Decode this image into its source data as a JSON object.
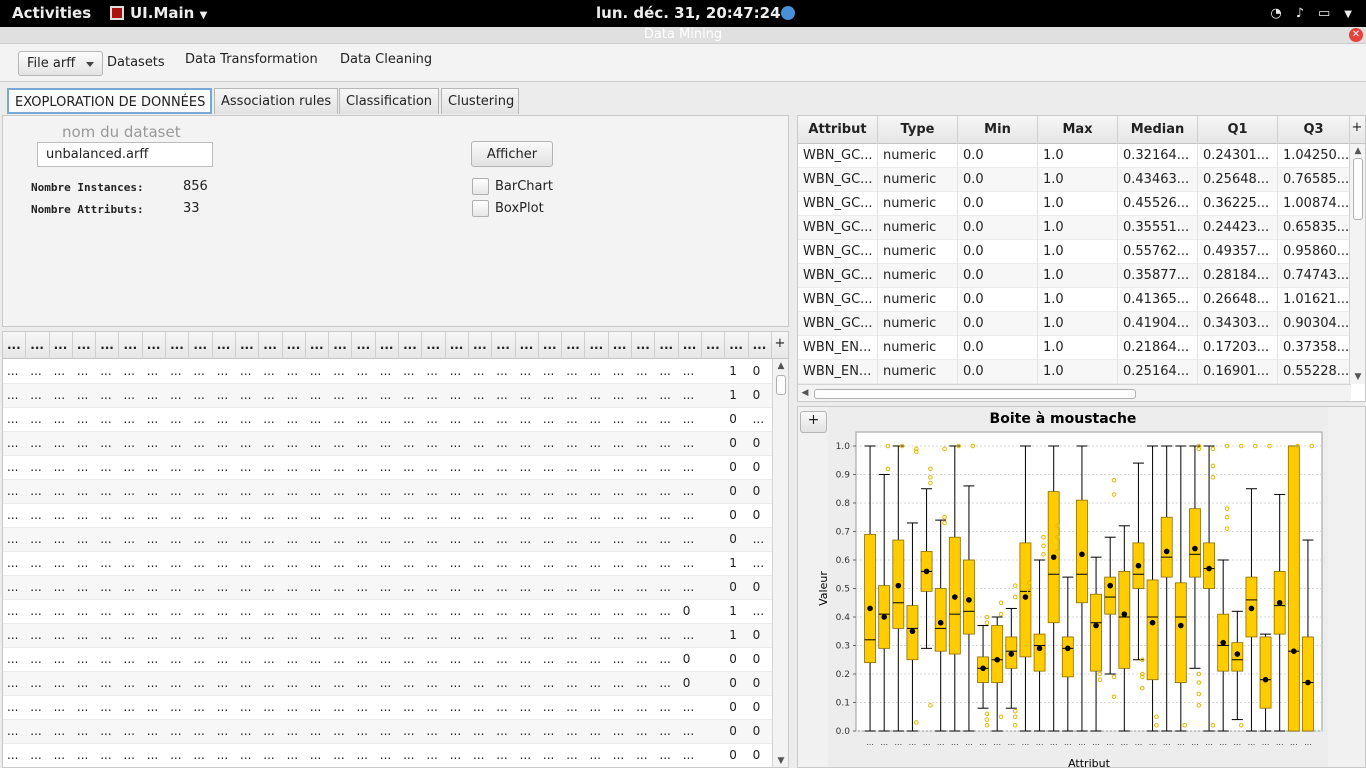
{
  "topbar": {
    "activities": "Activities",
    "app_menu": "UI.Main",
    "clock": "lun. déc. 31, 20:47:24"
  },
  "window": {
    "title": "Data Mining"
  },
  "menubar": {
    "file_button": "File arff",
    "items": [
      "Datasets",
      "Data Transformation",
      "Data Cleaning"
    ]
  },
  "tabs": [
    "EXOPLORATION DE DONNÉES",
    "Association rules",
    "Classification",
    "Clustering"
  ],
  "dataset": {
    "label": "nom du dataset",
    "value": "unbalanced.arff",
    "instances_label": "Nombre Instances:",
    "instances": "856",
    "attributes_label": "Nombre Attributs:",
    "attributes": "33",
    "afficher": "Afficher",
    "barchart": "BarChart",
    "boxplot": "BoxPlot"
  },
  "data_table": {
    "header_text": "...",
    "corner": "+",
    "cols": 33,
    "rows": [
      {
        "c30": "",
        "c31": "1",
        "c32": "0"
      },
      {
        "c30": "",
        "c31": "1",
        "c32": "0"
      },
      {
        "c30": "",
        "c31": "0",
        "c32": "..."
      },
      {
        "c30": "",
        "c31": "0",
        "c32": "0"
      },
      {
        "c30": "",
        "c31": "0",
        "c32": "0"
      },
      {
        "c30": "",
        "c31": "0",
        "c32": "0"
      },
      {
        "c30": "",
        "c31": "0",
        "c32": "0"
      },
      {
        "c30": "",
        "c31": "0",
        "c32": "..."
      },
      {
        "c30": "",
        "c31": "1",
        "c32": "..."
      },
      {
        "c30": "",
        "c31": "0",
        "c32": "0"
      },
      {
        "c29": "0",
        "c30": "",
        "c31": "1",
        "c32": "..."
      },
      {
        "c30": "",
        "c31": "1",
        "c32": "0"
      },
      {
        "c29": "0",
        "c30": "",
        "c31": "0",
        "c32": "0"
      },
      {
        "c29": "0",
        "c30": "",
        "c31": "0",
        "c32": "0"
      },
      {
        "c30": "",
        "c31": "0",
        "c32": "0"
      },
      {
        "c30": "",
        "c31": "0",
        "c32": "0"
      },
      {
        "c30": "",
        "c31": "0",
        "c32": "0"
      }
    ]
  },
  "stats_table": {
    "headers": [
      "Attribut",
      "Type",
      "Min",
      "Max",
      "Median",
      "Q1",
      "Q3"
    ],
    "corner": "+",
    "rows": [
      [
        "WBN_GC...",
        "numeric",
        "0.0",
        "1.0",
        "0.32164...",
        "0.24301...",
        "1.04250..."
      ],
      [
        "WBN_GC...",
        "numeric",
        "0.0",
        "1.0",
        "0.43463...",
        "0.25648...",
        "0.76585..."
      ],
      [
        "WBN_GC...",
        "numeric",
        "0.0",
        "1.0",
        "0.45526...",
        "0.36225...",
        "1.00874..."
      ],
      [
        "WBN_GC...",
        "numeric",
        "0.0",
        "1.0",
        "0.35551...",
        "0.24423...",
        "0.65835..."
      ],
      [
        "WBN_GC...",
        "numeric",
        "0.0",
        "1.0",
        "0.55762...",
        "0.49357...",
        "0.95860..."
      ],
      [
        "WBN_GC...",
        "numeric",
        "0.0",
        "1.0",
        "0.35877...",
        "0.28184...",
        "0.74743..."
      ],
      [
        "WBN_GC...",
        "numeric",
        "0.0",
        "1.0",
        "0.41365...",
        "0.26648...",
        "1.01621..."
      ],
      [
        "WBN_GC...",
        "numeric",
        "0.0",
        "1.0",
        "0.41904...",
        "0.34303...",
        "0.90304..."
      ],
      [
        "WBN_EN...",
        "numeric",
        "0.0",
        "1.0",
        "0.21864...",
        "0.17203...",
        "0.37358..."
      ],
      [
        "WBN_EN...",
        "numeric",
        "0.0",
        "1.0",
        "0.25164...",
        "0.16901...",
        "0.55228..."
      ]
    ]
  },
  "chart_panel": {
    "plus": "+"
  },
  "chart_data": {
    "type": "box",
    "title": "Boite à moustache",
    "xlabel": "Attribut",
    "ylabel": "Valeur",
    "ylim": [
      0,
      1
    ],
    "yticks": [
      "0.0",
      "0.1",
      "0.2",
      "0.3",
      "0.4",
      "0.5",
      "0.6",
      "0.7",
      "0.8",
      "0.9",
      "1.0"
    ],
    "category_label": "...",
    "colors": {
      "box": "#ffcc00",
      "box_stroke": "#8a6d00",
      "outlier": "#e6b800",
      "mean": "#000000",
      "grid": "#d8d8d8"
    },
    "boxes": [
      {
        "q1": 0.24,
        "med": 0.32,
        "q3": 0.69,
        "min": 0.0,
        "max": 1.0,
        "mean": 0.43
      },
      {
        "q1": 0.29,
        "med": 0.41,
        "q3": 0.51,
        "min": 0.0,
        "max": 0.9,
        "mean": 0.4
      },
      {
        "q1": 0.36,
        "med": 0.45,
        "q3": 0.67,
        "min": 0.0,
        "max": 1.0,
        "mean": 0.51
      },
      {
        "q1": 0.25,
        "med": 0.36,
        "q3": 0.44,
        "min": 0.0,
        "max": 0.73,
        "mean": 0.35
      },
      {
        "q1": 0.49,
        "med": 0.56,
        "q3": 0.63,
        "min": 0.29,
        "max": 0.85,
        "mean": 0.56
      },
      {
        "q1": 0.28,
        "med": 0.36,
        "q3": 0.5,
        "min": 0.0,
        "max": 0.74,
        "mean": 0.38
      },
      {
        "q1": 0.27,
        "med": 0.41,
        "q3": 0.68,
        "min": 0.0,
        "max": 1.0,
        "mean": 0.47
      },
      {
        "q1": 0.34,
        "med": 0.42,
        "q3": 0.6,
        "min": 0.0,
        "max": 0.86,
        "mean": 0.46
      },
      {
        "q1": 0.17,
        "med": 0.22,
        "q3": 0.26,
        "min": 0.08,
        "max": 0.37,
        "mean": 0.22
      },
      {
        "q1": 0.17,
        "med": 0.25,
        "q3": 0.37,
        "min": 0.0,
        "max": 0.4,
        "mean": 0.25
      },
      {
        "q1": 0.22,
        "med": 0.28,
        "q3": 0.33,
        "min": 0.08,
        "max": 0.43,
        "mean": 0.27
      },
      {
        "q1": 0.26,
        "med": 0.49,
        "q3": 0.66,
        "min": 0.0,
        "max": 1.0,
        "mean": 0.47
      },
      {
        "q1": 0.21,
        "med": 0.3,
        "q3": 0.34,
        "min": 0.0,
        "max": 0.6,
        "mean": 0.29
      },
      {
        "q1": 0.38,
        "med": 0.55,
        "q3": 0.84,
        "min": 0.0,
        "max": 1.0,
        "mean": 0.61
      },
      {
        "q1": 0.19,
        "med": 0.29,
        "q3": 0.33,
        "min": 0.0,
        "max": 0.54,
        "mean": 0.29
      },
      {
        "q1": 0.45,
        "med": 0.55,
        "q3": 0.81,
        "min": 0.0,
        "max": 1.0,
        "mean": 0.62
      },
      {
        "q1": 0.21,
        "med": 0.38,
        "q3": 0.48,
        "min": 0.0,
        "max": 0.61,
        "mean": 0.37
      },
      {
        "q1": 0.41,
        "med": 0.47,
        "q3": 0.54,
        "min": 0.2,
        "max": 0.68,
        "mean": 0.51
      },
      {
        "q1": 0.22,
        "med": 0.4,
        "q3": 0.56,
        "min": 0.0,
        "max": 0.72,
        "mean": 0.41
      },
      {
        "q1": 0.5,
        "med": 0.55,
        "q3": 0.66,
        "min": 0.25,
        "max": 0.94,
        "mean": 0.58
      },
      {
        "q1": 0.18,
        "med": 0.4,
        "q3": 0.53,
        "min": 0.0,
        "max": 1.0,
        "mean": 0.38
      },
      {
        "q1": 0.54,
        "med": 0.61,
        "q3": 0.75,
        "min": 0.0,
        "max": 1.0,
        "mean": 0.63
      },
      {
        "q1": 0.17,
        "med": 0.4,
        "q3": 0.52,
        "min": 0.0,
        "max": 1.0,
        "mean": 0.37
      },
      {
        "q1": 0.54,
        "med": 0.62,
        "q3": 0.78,
        "min": 0.22,
        "max": 1.0,
        "mean": 0.64
      },
      {
        "q1": 0.5,
        "med": 0.57,
        "q3": 0.66,
        "min": 0.0,
        "max": 1.0,
        "mean": 0.57
      },
      {
        "q1": 0.21,
        "med": 0.3,
        "q3": 0.41,
        "min": 0.0,
        "max": 0.6,
        "mean": 0.31
      },
      {
        "q1": 0.21,
        "med": 0.25,
        "q3": 0.31,
        "min": 0.04,
        "max": 0.42,
        "mean": 0.27
      },
      {
        "q1": 0.33,
        "med": 0.46,
        "q3": 0.54,
        "min": 0.0,
        "max": 0.85,
        "mean": 0.43
      },
      {
        "q1": 0.08,
        "med": 0.18,
        "q3": 0.33,
        "min": 0.0,
        "max": 0.34,
        "mean": 0.18
      },
      {
        "q1": 0.34,
        "med": 0.44,
        "q3": 0.56,
        "min": 0.0,
        "max": 0.83,
        "mean": 0.45
      },
      {
        "q1": 0.0,
        "med": 0.28,
        "q3": 1.0,
        "min": 0.0,
        "max": 1.0,
        "mean": 0.28
      },
      {
        "q1": 0.0,
        "med": 0.17,
        "q3": 0.33,
        "min": 0.0,
        "max": 0.67,
        "mean": 0.17
      }
    ],
    "outliers": [
      {
        "i": 1,
        "vals": [
          0.92,
          1.0
        ]
      },
      {
        "i": 2,
        "vals": [
          1.0
        ]
      },
      {
        "i": 3,
        "vals": [
          0.99,
          0.98,
          0.03
        ]
      },
      {
        "i": 4,
        "vals": [
          0.87,
          0.89,
          0.92,
          0.09
        ]
      },
      {
        "i": 5,
        "vals": [
          0.99,
          0.73,
          0.75
        ]
      },
      {
        "i": 6,
        "vals": [
          1.0
        ]
      },
      {
        "i": 7,
        "vals": [
          1.0
        ]
      },
      {
        "i": 8,
        "vals": [
          0.38,
          0.4,
          0.04,
          0.06,
          0.02
        ]
      },
      {
        "i": 9,
        "vals": [
          0.45,
          0.41,
          0.05
        ]
      },
      {
        "i": 10,
        "vals": [
          0.47,
          0.51,
          0.02,
          0.07,
          0.05
        ]
      },
      {
        "i": 11,
        "vals": [
          0.52,
          0.49
        ]
      },
      {
        "i": 12,
        "vals": [
          0.62,
          0.65,
          0.68
        ]
      },
      {
        "i": 13,
        "vals": [
          0.63,
          0.68,
          0.72
        ]
      },
      {
        "i": 16,
        "vals": [
          0.18,
          0.2
        ]
      },
      {
        "i": 17,
        "vals": [
          0.83,
          0.88,
          0.12,
          0.19
        ]
      },
      {
        "i": 19,
        "vals": [
          0.15,
          0.19,
          0.2,
          0.25
        ]
      },
      {
        "i": 20,
        "vals": [
          0.05,
          0.02
        ]
      },
      {
        "i": 22,
        "vals": [
          0.02
        ]
      },
      {
        "i": 23,
        "vals": [
          0.99,
          1.0,
          0.09,
          0.13,
          0.17,
          0.2
        ]
      },
      {
        "i": 24,
        "vals": [
          0.89,
          0.93,
          0.99,
          0.02
        ]
      },
      {
        "i": 25,
        "vals": [
          0.71,
          0.75,
          0.78,
          1.0
        ]
      },
      {
        "i": 26,
        "vals": [
          1.0,
          0.02
        ]
      },
      {
        "i": 27,
        "vals": [
          1.0
        ]
      },
      {
        "i": 28,
        "vals": [
          1.0
        ]
      },
      {
        "i": 30,
        "vals": [
          1.0
        ]
      },
      {
        "i": 31,
        "vals": [
          1.0
        ]
      }
    ]
  }
}
